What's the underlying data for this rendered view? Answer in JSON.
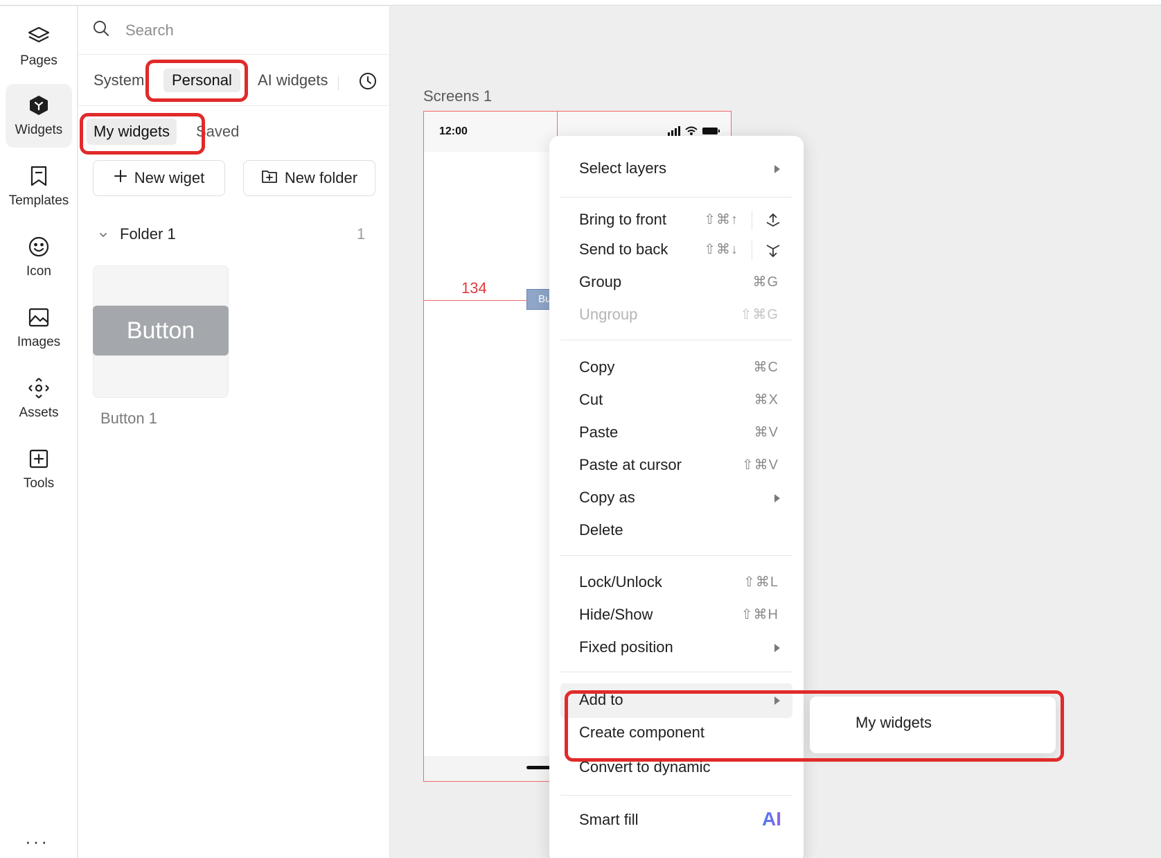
{
  "rail": {
    "items": [
      {
        "label": "Pages",
        "icon": "layers-icon"
      },
      {
        "label": "Widgets",
        "icon": "widget-cube-icon",
        "active": true
      },
      {
        "label": "Templates",
        "icon": "bookmark-icon"
      },
      {
        "label": "Icon",
        "icon": "smiley-icon"
      },
      {
        "label": "Images",
        "icon": "image-icon"
      },
      {
        "label": "Assets",
        "icon": "assets-diamond-icon"
      },
      {
        "label": "Tools",
        "icon": "plus-square-icon"
      }
    ],
    "more": "···"
  },
  "panel": {
    "search_placeholder": "Search",
    "tabs": [
      "System",
      "Personal",
      "AI widgets"
    ],
    "active_tab": "Personal",
    "subtabs": [
      "My widgets",
      "Saved"
    ],
    "active_subtab": "My widgets",
    "new_widget_label": "New wiget",
    "new_folder_label": "New folder",
    "folder": {
      "name": "Folder 1",
      "count": "1"
    },
    "widget": {
      "preview_text": "Button",
      "caption": "Button 1"
    }
  },
  "canvas": {
    "title": "Screens 1",
    "time": "12:00",
    "measure": "134",
    "button_text": "Bu"
  },
  "menu": {
    "select_layers": "Select layers",
    "bring_front": {
      "label": "Bring to front",
      "shortcut": "⇧⌘↑"
    },
    "send_back": {
      "label": "Send to back",
      "shortcut": "⇧⌘↓"
    },
    "group": {
      "label": "Group",
      "shortcut": "⌘G"
    },
    "ungroup": {
      "label": "Ungroup",
      "shortcut": "⇧⌘G"
    },
    "copy": {
      "label": "Copy",
      "shortcut": "⌘C"
    },
    "cut": {
      "label": "Cut",
      "shortcut": "⌘X"
    },
    "paste": {
      "label": "Paste",
      "shortcut": "⌘V"
    },
    "paste_cursor": {
      "label": "Paste at cursor",
      "shortcut": "⇧⌘V"
    },
    "copy_as": "Copy as",
    "delete": "Delete",
    "lock": {
      "label": "Lock/Unlock",
      "shortcut": "⇧⌘L"
    },
    "hide": {
      "label": "Hide/Show",
      "shortcut": "⇧⌘H"
    },
    "fixed": "Fixed position",
    "add_to": "Add to",
    "create_component": "Create component",
    "convert_dynamic": "Convert to dynamic",
    "smart_fill": "Smart fill",
    "ai_badge": "AI"
  },
  "submenu": {
    "item": "My widgets"
  },
  "colors": {
    "annotation": "#e12a2a",
    "frame_border": "#f06a6a",
    "measure": "#e03a3a"
  }
}
